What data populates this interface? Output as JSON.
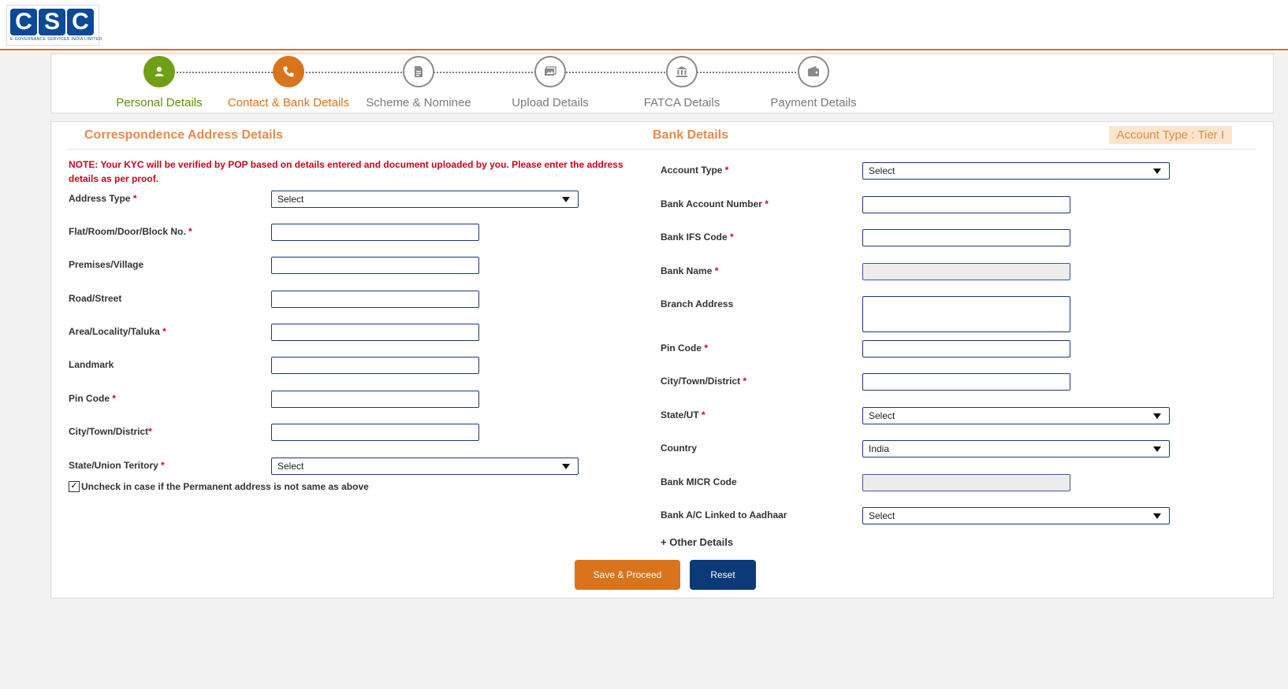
{
  "logo": {
    "letters": [
      "C",
      "S",
      "C"
    ],
    "tagline": "E-GOVERNANCE SERVICES INDIA LIMITED"
  },
  "steps": [
    {
      "label": "Personal Details",
      "icon": "person-icon",
      "state": "done"
    },
    {
      "label": "Contact & Bank Details",
      "icon": "phone-icon",
      "state": "active"
    },
    {
      "label": "Scheme & Nominee",
      "icon": "document-icon",
      "state": "pending"
    },
    {
      "label": "Upload Details",
      "icon": "upload-image-icon",
      "state": "pending"
    },
    {
      "label": "FATCA Details",
      "icon": "bank-icon",
      "state": "pending"
    },
    {
      "label": "Payment Details",
      "icon": "wallet-icon",
      "state": "pending"
    }
  ],
  "correspondence": {
    "title": "Correspondence Address Details",
    "note": "NOTE: Your KYC will be verified by POP based on details entered and document uploaded by you. Please enter the address details as per proof.",
    "address_type": {
      "label": "Address Type",
      "value": "Select"
    },
    "flat": {
      "label": "Flat/Room/Door/Block No."
    },
    "premises": {
      "label": "Premises/Village"
    },
    "road": {
      "label": "Road/Street"
    },
    "area": {
      "label": "Area/Locality/Taluka"
    },
    "landmark": {
      "label": "Landmark"
    },
    "pin": {
      "label": "Pin Code"
    },
    "city": {
      "label": "City/Town/District"
    },
    "state": {
      "label": "State/Union Teritory",
      "value": "Select"
    },
    "checkbox_label": "Uncheck in case if the Permanent address is not same as above",
    "checkbox_mark": "✓",
    "required_mark": "*"
  },
  "bank": {
    "title": "Bank Details",
    "account_type_badge": "Account Type : Tier I",
    "account_type": {
      "label": "Account Type",
      "value": "Select"
    },
    "account_number": {
      "label": "Bank Account Number"
    },
    "ifs": {
      "label": "Bank IFS Code"
    },
    "name": {
      "label": "Bank Name"
    },
    "branch": {
      "label": "Branch Address"
    },
    "pin": {
      "label": "Pin Code"
    },
    "city": {
      "label": "City/Town/District"
    },
    "state": {
      "label": "State/UT",
      "value": "Select"
    },
    "country": {
      "label": "Country",
      "value": "India"
    },
    "micr": {
      "label": "Bank MICR Code"
    },
    "aadhaar": {
      "label": "Bank A/C Linked to Aadhaar",
      "value": "Select"
    },
    "other_details": "+ Other Details"
  },
  "buttons": {
    "save": "Save & Proceed",
    "reset": "Reset"
  },
  "colors": {
    "accent": "#d9741c",
    "done": "#6e9f16",
    "navy": "#0c3a78",
    "required": "#d0021b"
  }
}
